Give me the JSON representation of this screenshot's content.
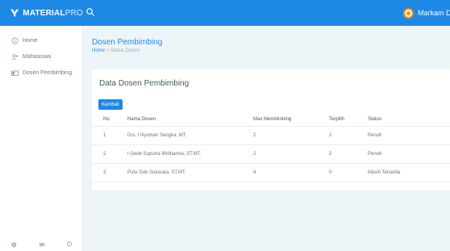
{
  "brand": {
    "name_bold": "MATERIAL",
    "name_light": "PRO"
  },
  "header": {
    "user_name": "Markam Da"
  },
  "sidebar": {
    "items": [
      {
        "label": "Home",
        "icon": "info-circle-icon"
      },
      {
        "label": "Mahasiswa",
        "icon": "users-icon"
      },
      {
        "label": "Dosen Pembimbing",
        "icon": "id-card-icon"
      }
    ],
    "footer_icons": [
      "settings-icon",
      "mail-icon",
      "power-icon"
    ]
  },
  "page": {
    "title": "Dosen Pembimbing",
    "breadcrumb": {
      "home": "Home",
      "separator": ">",
      "current": "Status Dosen"
    }
  },
  "card": {
    "title": "Data Dosen Pembimbing",
    "back_button": "Kembali",
    "table": {
      "headers": [
        "No",
        "Nama Dosen",
        "Max Membimbing",
        "Terpilih",
        "Status"
      ],
      "rows": [
        {
          "no": "1",
          "nama": "Drs. I Nyoman Sangka, MT.",
          "max": "2",
          "terpilih": "2",
          "status": "Penuh"
        },
        {
          "no": "2",
          "nama": "I Gede Suputra Widharma, ST.MT.",
          "max": "2",
          "terpilih": "2",
          "status": "Penuh"
        },
        {
          "no": "3",
          "nama": "Putu Gde Sukarata, ST.MT.",
          "max": "4",
          "terpilih": "0",
          "status": "Masih Tersedia"
        }
      ]
    }
  },
  "colors": {
    "primary": "#1e88e5",
    "background": "#eef5f9",
    "text": "#455a64"
  }
}
